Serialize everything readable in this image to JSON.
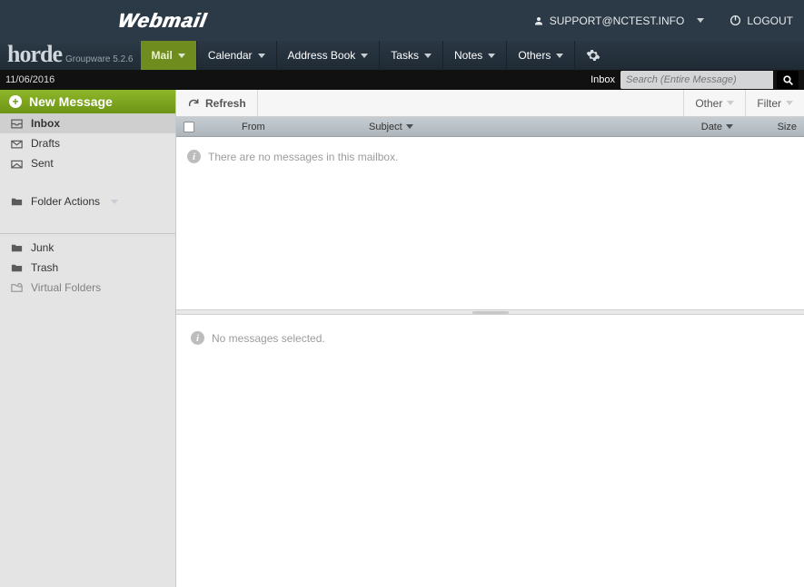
{
  "topbar": {
    "brand": "Webmail",
    "user": "SUPPORT@NCTEST.INFO",
    "logout": "LOGOUT"
  },
  "app": {
    "logo_main": "horde",
    "logo_sub": "Groupware 5.2.6"
  },
  "nav": {
    "items": [
      "Mail",
      "Calendar",
      "Address Book",
      "Tasks",
      "Notes",
      "Others"
    ],
    "active_index": 0
  },
  "strip": {
    "date": "11/06/2016",
    "current_folder": "Inbox",
    "search_placeholder": "Search (Entire Message)"
  },
  "sidebar": {
    "new_message": "New Message",
    "folders": [
      {
        "label": "Inbox",
        "icon": "inbox",
        "bold": true,
        "selected": true
      },
      {
        "label": "Drafts",
        "icon": "drafts",
        "bold": false,
        "selected": false
      },
      {
        "label": "Sent",
        "icon": "sent",
        "bold": false,
        "selected": false
      }
    ],
    "folder_actions": "Folder Actions",
    "lower": [
      {
        "label": "Junk",
        "icon": "folder"
      },
      {
        "label": "Trash",
        "icon": "folder"
      }
    ],
    "virtual_folders": "Virtual Folders"
  },
  "toolbar": {
    "refresh": "Refresh",
    "other": "Other",
    "filter": "Filter"
  },
  "columns": {
    "from": "From",
    "subject": "Subject",
    "date": "Date",
    "size": "Size"
  },
  "list": {
    "empty_text": "There are no messages in this mailbox."
  },
  "preview": {
    "empty_text": "No messages selected."
  }
}
